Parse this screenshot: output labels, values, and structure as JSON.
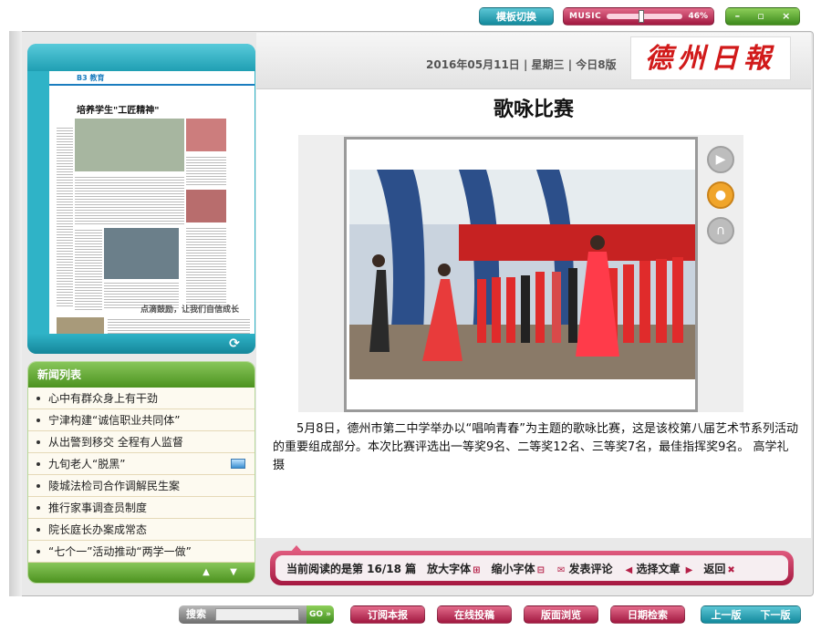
{
  "topbar": {
    "template_switch": "模板切换",
    "music_label": "MUSIC",
    "music_volume": "46%",
    "music_volume_value": 0.46,
    "window_controls": [
      "–",
      "▫",
      "×"
    ]
  },
  "thumbnail": {
    "page_label": "B3",
    "section": "教育",
    "headline": "培养学生\"工匠精神\"",
    "bottom_headline": "点滴鼓励，让我们自信成长"
  },
  "news": {
    "heading": "新闻列表",
    "items": [
      {
        "label": "心中有群众身上有干劲",
        "has_picture": false
      },
      {
        "label": "宁津构建“诚信职业共同体”",
        "has_picture": false
      },
      {
        "label": "从出警到移交 全程有人监督",
        "has_picture": false
      },
      {
        "label": "九旬老人“脱黑”",
        "has_picture": true
      },
      {
        "label": "陵城法检司合作调解民生案",
        "has_picture": false
      },
      {
        "label": "推行家事调查员制度",
        "has_picture": false
      },
      {
        "label": "院长庭长办案成常态",
        "has_picture": false
      },
      {
        "label": "“七个一”活动推动“两学一做”",
        "has_picture": false
      }
    ],
    "up_icon": "up-arrow-icon",
    "down_icon": "down-arrow-icon"
  },
  "masthead": {
    "date_line": "2016年05月11日 | 星期三 | 今日8版",
    "logo_text": "德州日報"
  },
  "article": {
    "title": "歌咏比赛",
    "body": "5月8日，德州市第二中学举办以“唱响青春”为主题的歌咏比赛，这是该校第八届艺术节系列活动的重要组成部分。本次比赛评选出一等奖9名、二等奖12名、三等奖7名，最佳指挥奖9名。 高学礼摄",
    "side_icons": [
      "video-icon",
      "person-icon",
      "headphones-icon"
    ]
  },
  "reading_bar": {
    "progress": "当前阅读的是第 16/18 篇",
    "zoom_in": "放大字体",
    "zoom_out": "缩小字体",
    "comment": "发表评论",
    "select_article": "选择文章",
    "back": "返回"
  },
  "bottom_bar": {
    "search_label": "搜索",
    "go_label": "GO »",
    "subscribe": "订阅本报",
    "submit": "在线投稿",
    "page_browse": "版面浏览",
    "date_search": "日期检索",
    "prev_page": "上一版",
    "next_page": "下一版"
  },
  "colors": {
    "teal": "#2fb3c7",
    "pink": "#c02350",
    "green": "#5da52d",
    "logo_red": "#d11a1a"
  }
}
